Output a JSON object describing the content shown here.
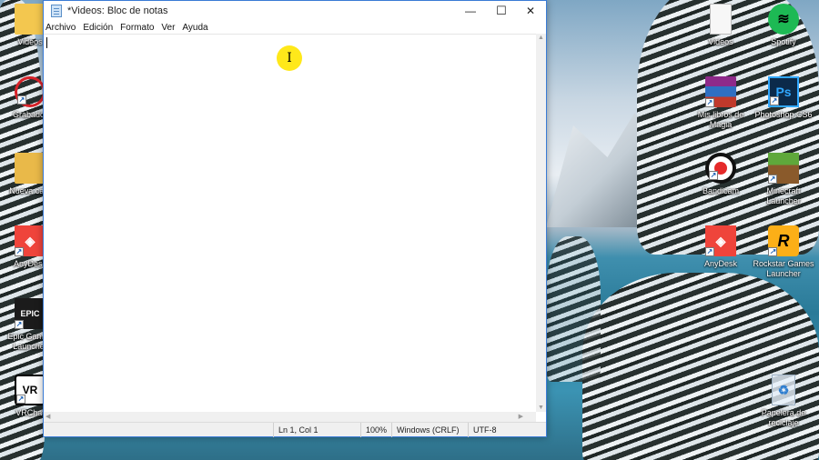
{
  "window": {
    "title": "*Videos: Bloc de notas",
    "controls": {
      "minimize": "—",
      "maximize": "☐",
      "close": "✕"
    },
    "menu": [
      "Archivo",
      "Edición",
      "Formato",
      "Ver",
      "Ayuda"
    ],
    "editor_text": "",
    "status": {
      "position": "Ln 1, Col 1",
      "zoom": "100%",
      "line_ending": "Windows (CRLF)",
      "encoding": "UTF-8"
    }
  },
  "desktop_left_icons": [
    {
      "label": "Videos",
      "icon": "folder-icon"
    },
    {
      "label": "Grabador",
      "icon": "recorder-icon"
    },
    {
      "label": "Nueva ca...",
      "icon": "folder-icon"
    },
    {
      "label": "AnyDesk",
      "icon": "anydesk-icon"
    },
    {
      "label": "Epic Games Launcher",
      "icon": "epic-games-icon"
    },
    {
      "label": "VRChat",
      "icon": "vrchat-icon"
    }
  ],
  "desktop_right_icons": [
    {
      "label": "Videos",
      "icon": "document-icon"
    },
    {
      "label": "Spotify",
      "icon": "spotify-icon"
    },
    {
      "label": "Mis libros de Magia",
      "icon": "winrar-icon"
    },
    {
      "label": "Photoshop CS6",
      "icon": "photoshop-icon"
    },
    {
      "label": "Bandicam",
      "icon": "bandicam-icon"
    },
    {
      "label": "Minecraft Launcher",
      "icon": "minecraft-icon"
    },
    {
      "label": "AnyDesk",
      "icon": "anydesk-icon"
    },
    {
      "label": "Rockstar Games Launcher",
      "icon": "rockstar-icon"
    },
    {
      "label": "Papelera de reciclaje",
      "icon": "recycle-bin-icon"
    }
  ],
  "icon_glyphs": {
    "ps": "Ps",
    "vr": "VR",
    "epic": "EPIC",
    "rockstar": "R",
    "text_cursor": "I"
  },
  "colors": {
    "window_border": "#3a7bd5",
    "cursor_highlight": "#ffe81a",
    "anydesk": "#ef443b",
    "spotify": "#1db954",
    "photoshop": "#0b2a4a",
    "rockstar": "#fcaf17"
  }
}
